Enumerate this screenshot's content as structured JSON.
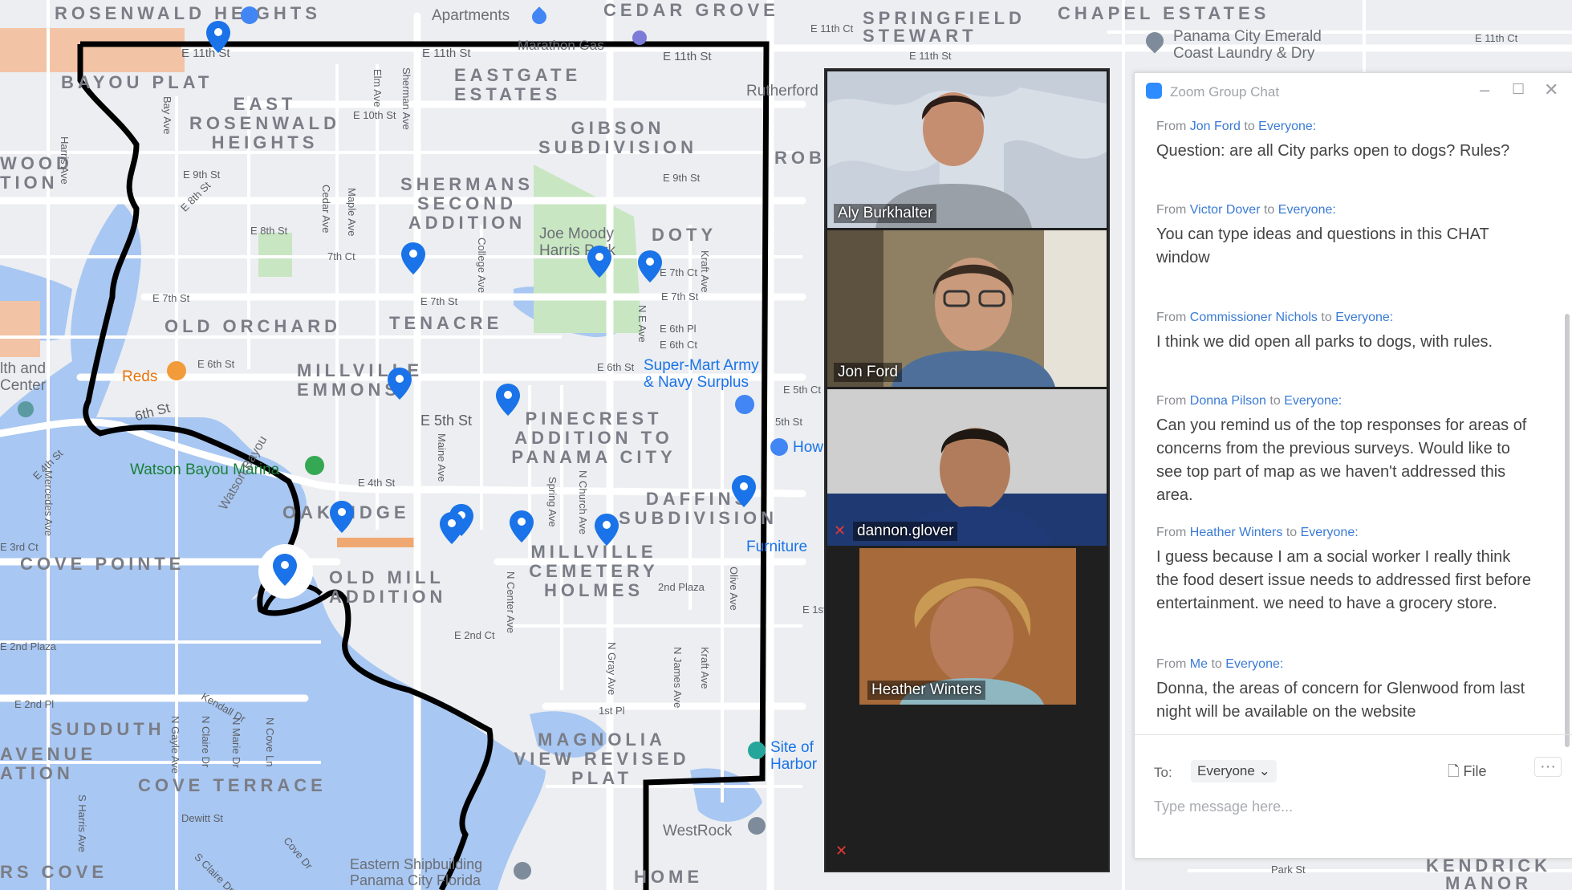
{
  "map": {
    "neighborhoods": [
      {
        "id": "rosenwald-heights",
        "text": "ROSENWALD HEIGHTS"
      },
      {
        "id": "cedar-grove",
        "text": "CEDAR GROVE"
      },
      {
        "id": "springfield-stewart",
        "text": "SPRINGFIELD STEWART"
      },
      {
        "id": "chapel-estates",
        "text": "CHAPEL ESTATES"
      },
      {
        "id": "bayou-plat",
        "text": "BAYOU PLAT"
      },
      {
        "id": "eastgate-estates",
        "text": "EASTGATE ESTATES"
      },
      {
        "id": "east-rosenwald-heights",
        "text": "EAST ROSENWALD HEIGHTS"
      },
      {
        "id": "gibson-subdivision",
        "text": "GIBSON SUBDIVISION"
      },
      {
        "id": "shermans-second-addition",
        "text": "SHERMANS SECOND ADDITION"
      },
      {
        "id": "doty",
        "text": "DOTY"
      },
      {
        "id": "old-orchard",
        "text": "OLD ORCHARD"
      },
      {
        "id": "tenacre",
        "text": "TENACRE"
      },
      {
        "id": "millville-emmons",
        "text": "MILLVILLE EMMONS"
      },
      {
        "id": "pinecrest",
        "text": "PINECREST ADDITION TO PANAMA CITY"
      },
      {
        "id": "daffins",
        "text": "DAFFINS SUBDIVISION"
      },
      {
        "id": "oakridge",
        "text": "OAKRIDGE"
      },
      {
        "id": "cove-pointe",
        "text": "COVE POINTE"
      },
      {
        "id": "old-mill",
        "text": "OLD MILL ADDITION"
      },
      {
        "id": "millville-cemetery",
        "text": "MILLVILLE CEMETERY HOLMES"
      },
      {
        "id": "sudduth",
        "text": "SUDDUTH"
      },
      {
        "id": "avenue",
        "text": "AVENUE ATION"
      },
      {
        "id": "cove-terrace",
        "text": "COVE TERRACE"
      },
      {
        "id": "magnolia-view",
        "text": "MAGNOLIA VIEW REVISED PLAT"
      },
      {
        "id": "rs-cove",
        "text": "RS COVE"
      },
      {
        "id": "home",
        "text": "HOME"
      },
      {
        "id": "kendrick-manor",
        "text": "KENDRICK MANOR"
      },
      {
        "id": "wood-tion",
        "text": "WOOD TION"
      },
      {
        "id": "rob",
        "text": "ROB"
      }
    ],
    "pois": {
      "apartments": "Apartments",
      "marathon": "Marathon Gas",
      "panama_laundry": "Panama City Emerald Coast Laundry & Dry",
      "rutherford": "Rutherford",
      "joe_moody": "Joe Moody Harris Park",
      "super_mart": "Super-Mart Army & Navy Surplus",
      "reds": "Reds",
      "health_center": "lth and Center",
      "watson_marina": "Watson Bayou Marina",
      "watson_bayou": "Watson Bayou",
      "furniture": "Furniture",
      "how": "How",
      "site_of": "Site of Harbor",
      "westrock": "WestRock",
      "eastern_ship": "Eastern Shipbuilding Panama City Florida"
    },
    "streets": {
      "e11": "E 11th St",
      "e11b": "E 11th St",
      "e11c": "E 11th St",
      "e11d": "E 11th St",
      "e11ct": "E 11th Ct",
      "e11ct2": "E 11th Ct",
      "e10": "E 10th St",
      "e9": "E 9th St",
      "e9b": "E 9th St",
      "e8": "E 8th St",
      "e8b": "E 8th St",
      "e7": "E 7th St",
      "e7b": "E 7th St",
      "e7c": "E 7th St",
      "e7ct": "7th Ct",
      "e7ct2": "E 7th Ct",
      "e6": "6th St",
      "e6b": "E 6th St",
      "e6c": "E 6th St",
      "e6pl": "E 6th Pl",
      "e6ct": "E 6th Ct",
      "e5": "E 5th St",
      "e5b": "5th St",
      "e5ct": "E 5th Ct",
      "e4": "E 4th St",
      "e4b": "E 4th St",
      "e3ct": "E 3rd Ct",
      "e2pl": "E 2nd Plaza",
      "e2ct": "E 2nd Ct",
      "e2": "E 2nd Pl",
      "e2plaza": "2nd Plaza",
      "e1pl": "1st Pl",
      "e1pl2": "E 1st Pl",
      "sherman": "Sherman Ave",
      "elm": "Elm Ave",
      "cedar": "Cedar Ave",
      "maple": "Maple Ave",
      "college": "College Ave",
      "kraft": "Kraft Ave",
      "ne": "N E Ave",
      "church": "N Church Ave",
      "spring": "Spring Ave",
      "maine": "Maine Ave",
      "olive": "Olive Ave",
      "harris": "Harris Ave",
      "bay": "Bay Ave",
      "mercedes": "Mercedes Ave",
      "center": "N Center Ave",
      "gray": "N Gray Ave",
      "james": "N James Ave",
      "kraft2": "Kraft Ave",
      "gayle": "N Gayle Ave",
      "claire": "N Claire Dr",
      "marie": "N Marie Dr",
      "cove": "N Cove Ln",
      "cove_dr": "Cove Dr",
      "kendall": "Kendall Dr",
      "dewitt": "Dewitt St",
      "park": "Park St",
      "harris2": "S Harris Ave",
      "stclaire": "S Claire Dr"
    }
  },
  "video": {
    "participants": [
      {
        "name": "Aly Burkhalter",
        "muted": false
      },
      {
        "name": "Jon Ford",
        "muted": false
      },
      {
        "name": "dannon.glover",
        "muted": true
      },
      {
        "name": "Heather Winters",
        "muted": false
      }
    ],
    "self_muted": true
  },
  "chat": {
    "title": "Zoom Group Chat",
    "messages": [
      {
        "from_label": "From",
        "sender": "Jon Ford",
        "to_label": "to",
        "recipient": "Everyone:",
        "text": "Question: are all City parks open to dogs? Rules?"
      },
      {
        "from_label": "From",
        "sender": "Victor Dover",
        "to_label": "to",
        "recipient": "Everyone:",
        "text": "You can type ideas and questions in this CHAT window"
      },
      {
        "from_label": "From",
        "sender": "Commissioner Nichols",
        "to_label": "to",
        "recipient": "Everyone:",
        "text": "I think we did open all parks to dogs, with rules."
      },
      {
        "from_label": "From",
        "sender": "Donna Pilson",
        "to_label": "to",
        "recipient": "Everyone:",
        "text": "Can you remind us of the top responses for areas of concerns from the previous surveys. Would like to see top part of map as we haven't addressed  this area."
      },
      {
        "from_label": "From",
        "sender": "Heather Winters",
        "to_label": "to",
        "recipient": "Everyone:",
        "text": "I guess because I  am a social worker I really think the food desert issue needs to addressed first before entertainment. we need to have a grocery store."
      },
      {
        "from_label": "From",
        "sender": "Me",
        "to_label": "to",
        "recipient": "Everyone:",
        "text": "Donna, the areas of concern for Glenwood from last night will be available on the website"
      }
    ],
    "to_label": "To:",
    "to_value": "Everyone",
    "file_label": "File",
    "more_label": "···",
    "placeholder": "Type message here..."
  },
  "colors": {
    "water": "#a8c7f2",
    "park": "#c8e6c2",
    "boundary": "#000000",
    "pin": "#1a73e8",
    "chat_link": "#3a7bd5"
  }
}
